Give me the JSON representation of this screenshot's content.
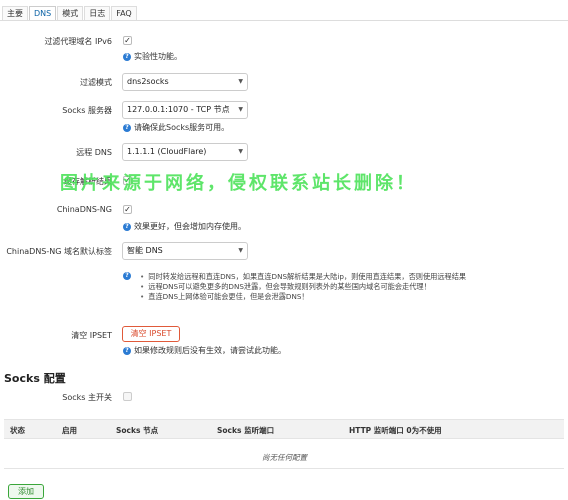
{
  "tabs": [
    "主要",
    "DNS",
    "模式",
    "日志",
    "FAQ"
  ],
  "active_tab": "DNS",
  "fields": {
    "filter_ipv6": {
      "label": "过滤代理域名 IPv6",
      "help": "实验性功能。"
    },
    "filter_mode": {
      "label": "过滤模式",
      "value": "dns2socks"
    },
    "socks_server": {
      "label": "Socks 服务器",
      "value": "127.0.0.1:1070 - TCP 节点",
      "help": "请确保此Socks服务可用。"
    },
    "remote_dns": {
      "label": "远程 DNS",
      "value": "1.1.1.1 (CloudFlare)"
    },
    "cache": {
      "label": "缓存解析结果"
    },
    "chinadns": {
      "label": "ChinaDNS-NG",
      "help": "效果更好，但会增加内存使用。"
    },
    "chinadns_tag": {
      "label": "ChinaDNS-NG 域名默认标签",
      "value": "智能 DNS",
      "bullets": [
        "同时转发给远程和直连DNS，如果直连DNS解析结果是大陆ip，则使用直连结果，否则使用远程结果",
        "远程DNS可以避免更多的DNS泄露，但会导致规则列表外的某些国内域名可能会走代理！",
        "直连DNS上网体验可能会更佳，但是会泄露DNS！"
      ]
    },
    "clear_ipset": {
      "label": "清空 IPSET",
      "button": "清空 IPSET",
      "help": "如果修改规则后没有生效，请尝试此功能。"
    }
  },
  "socks": {
    "title": "Socks 配置",
    "main_switch_label": "Socks 主开关",
    "columns": [
      "状态",
      "启用",
      "Socks 节点",
      "Socks 监听端口",
      "HTTP 监听端口 0为不使用"
    ],
    "empty_text": "尚无任何配置",
    "add_button": "添加"
  },
  "watermark": "图片来源于网络，侵权联系站长删除！"
}
